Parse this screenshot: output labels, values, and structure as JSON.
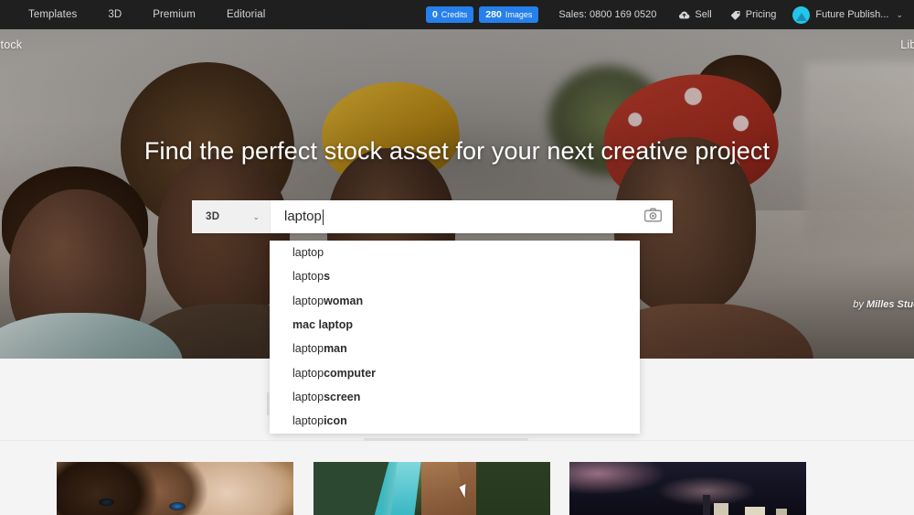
{
  "topnav": {
    "links": [
      {
        "label": "Templates",
        "name": "templates"
      },
      {
        "label": "3D",
        "name": "3d"
      },
      {
        "label": "Premium",
        "name": "premium"
      },
      {
        "label": "Editorial",
        "name": "editorial"
      }
    ],
    "credits_badge": {
      "count": "0",
      "label": "Credits"
    },
    "images_badge": {
      "count": "280",
      "label": "Images"
    },
    "sales": "Sales: 0800 169 0520",
    "sell": "Sell",
    "pricing": "Pricing",
    "account": "Future Publish...",
    "chevron": "⌄",
    "accent_blue": "#2680eb",
    "bar_bg": "#1f1f1f"
  },
  "subnav": {
    "brand": "Stock",
    "library": "Libra"
  },
  "hero": {
    "title": "Find the perfect stock asset for your next creative project",
    "credit_prefix": "by ",
    "credit_author": "Milles Stud"
  },
  "search": {
    "category": "3D",
    "category_caret": "⌄",
    "query": "laptop",
    "camera_icon": "camera-icon"
  },
  "suggestions": [
    {
      "prefix": "laptop",
      "completion": ""
    },
    {
      "prefix": "laptop",
      "completion": "s"
    },
    {
      "prefix": "laptop ",
      "completion": "woman"
    },
    {
      "prefix": "",
      "completion": "mac laptop"
    },
    {
      "prefix": "laptop ",
      "completion": "man"
    },
    {
      "prefix": "laptop ",
      "completion": "computer"
    },
    {
      "prefix": "laptop ",
      "completion": "screen"
    },
    {
      "prefix": "laptop ",
      "completion": "icon"
    }
  ],
  "thumbnails": [
    {
      "name": "thumbnail-two-women-portrait"
    },
    {
      "name": "thumbnail-aerial-forest-river"
    },
    {
      "name": "thumbnail-night-city-sky"
    }
  ]
}
